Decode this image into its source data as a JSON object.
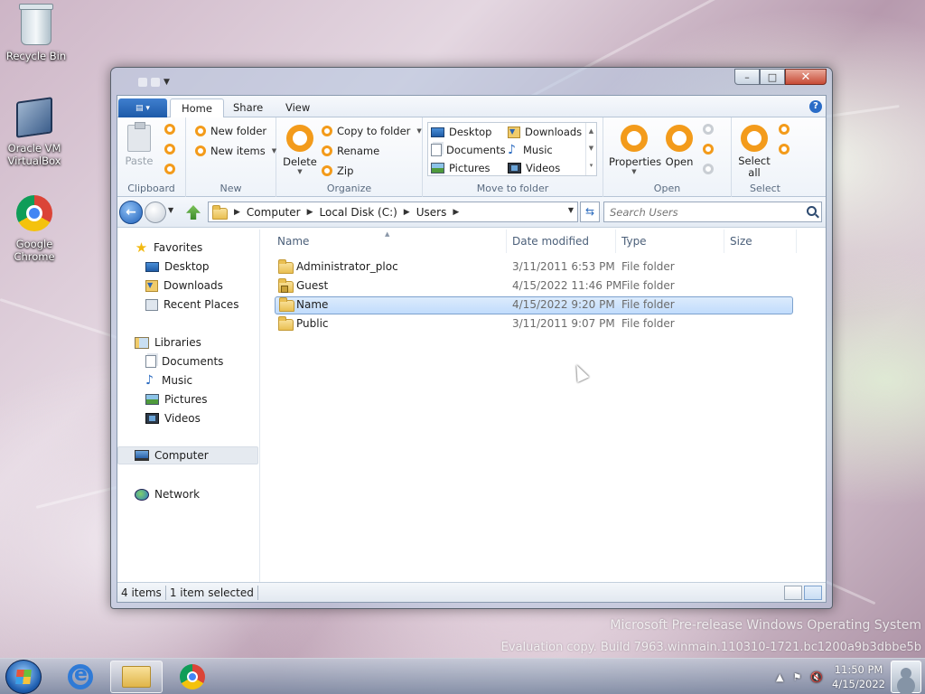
{
  "desktop": {
    "icons": [
      {
        "label": "Recycle Bin"
      },
      {
        "label": "Oracle VM VirtualBox"
      },
      {
        "label": "Google Chrome"
      }
    ],
    "watermark_line1": "Microsoft Pre-release Windows Operating System",
    "watermark_line2": "Evaluation copy. Build 7963.winmain.110310-1721.bc1200a9b3dbbe5b"
  },
  "window": {
    "title": "",
    "buttons": {
      "minimize": "–",
      "maximize": "□",
      "close": "✕"
    }
  },
  "ribbon": {
    "file_icon": "file-menu-icon",
    "tabs": [
      {
        "label": "Home",
        "active": true
      },
      {
        "label": "Share",
        "active": false
      },
      {
        "label": "View",
        "active": false
      }
    ],
    "help": "?",
    "groups": {
      "clipboard": {
        "label": "Clipboard",
        "paste": "Paste"
      },
      "new": {
        "label": "New",
        "new_folder": "New folder",
        "new_items": "New items"
      },
      "organize": {
        "label": "Organize",
        "delete": "Delete",
        "copy_to_folder": "Copy to folder",
        "rename": "Rename",
        "zip": "Zip"
      },
      "move_to_folder": {
        "label": "Move to folder",
        "items": [
          "Desktop",
          "Downloads",
          "Documents",
          "Music",
          "Pictures",
          "Videos"
        ]
      },
      "open": {
        "label": "Open",
        "properties": "Properties",
        "open": "Open"
      },
      "select": {
        "label": "Select",
        "select_all_line1": "Select",
        "select_all_line2": "all"
      }
    }
  },
  "address_bar": {
    "breadcrumb": [
      "Computer",
      "Local Disk (C:)",
      "Users"
    ],
    "search_placeholder": "Search Users"
  },
  "nav_pane": {
    "favorites": {
      "label": "Favorites",
      "items": [
        "Desktop",
        "Downloads",
        "Recent Places"
      ]
    },
    "libraries": {
      "label": "Libraries",
      "items": [
        "Documents",
        "Music",
        "Pictures",
        "Videos"
      ]
    },
    "computer": "Computer",
    "network": "Network"
  },
  "file_list": {
    "columns": [
      "Name",
      "Date modified",
      "Type",
      "Size"
    ],
    "rows": [
      {
        "name": "Administrator_ploc",
        "date": "3/11/2011 6:53 PM",
        "type": "File folder",
        "selected": false
      },
      {
        "name": "Guest",
        "date": "4/15/2022 11:46 PM",
        "type": "File folder",
        "selected": false
      },
      {
        "name": "Name",
        "date": "4/15/2022 9:20 PM",
        "type": "File folder",
        "selected": true
      },
      {
        "name": "Public",
        "date": "3/11/2011 9:07 PM",
        "type": "File folder",
        "selected": false
      }
    ]
  },
  "status_bar": {
    "item_count": "4 items",
    "selection": "1 item selected"
  },
  "taskbar": {
    "clock_time": "11:50 PM",
    "clock_date": "4/15/2022"
  },
  "colors": {
    "accent_orange": "#f39b1b",
    "selection_blue": "#c1dcfc",
    "ribbon_file_blue": "#1d5aa8"
  }
}
